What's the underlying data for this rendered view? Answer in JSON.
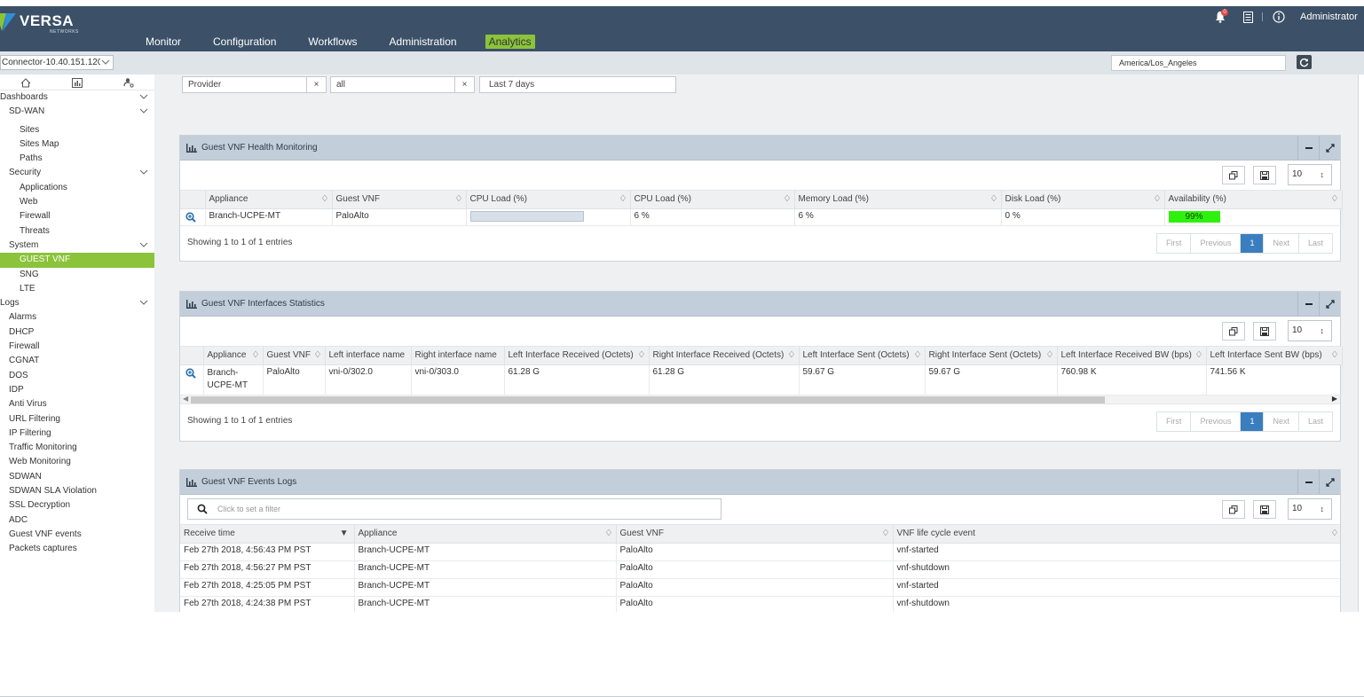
{
  "brand": {
    "name": "VERSA",
    "sub": "NETWORKS"
  },
  "nav": {
    "items": [
      "Monitor",
      "Configuration",
      "Workflows",
      "Administration",
      "Analytics"
    ],
    "active": "Analytics"
  },
  "topbar": {
    "notification_count": "0",
    "user": "Administrator"
  },
  "org_select": "Connector-10.40.151.120",
  "timezone": "America/Los_Angeles",
  "sidebar": {
    "dashboards": "Dashboards",
    "sdwan": "SD-WAN",
    "sdwan_items": [
      "Sites",
      "Sites Map",
      "Paths"
    ],
    "security": "Security",
    "security_items": [
      "Applications",
      "Web",
      "Firewall",
      "Threats"
    ],
    "system": "System",
    "system_items": [
      "GUEST VNF",
      "SNG",
      "LTE"
    ],
    "logs": "Logs",
    "log_items": [
      "Alarms",
      "DHCP",
      "Firewall",
      "CGNAT",
      "DOS",
      "IDP",
      "Anti Virus",
      "URL Filtering",
      "IP Filtering",
      "Traffic Monitoring",
      "Web Monitoring",
      "SDWAN",
      "SDWAN SLA Violation",
      "SSL Decryption",
      "ADC",
      "Guest VNF events",
      "Packets captures"
    ]
  },
  "filters": {
    "provider": "Provider",
    "tenant": "all",
    "range": "Last 7 days",
    "clear": "×"
  },
  "health": {
    "title": "Guest VNF Health Monitoring",
    "page_size": "10",
    "columns": [
      "Appliance",
      "Guest VNF",
      "CPU Load (%)",
      "CPU Load (%)",
      "Memory Load (%)",
      "Disk Load (%)",
      "Availability (%)"
    ],
    "row": {
      "appliance": "Branch-UCPE-MT",
      "vnf": "PaloAlto",
      "cpu_pct": "6 %",
      "mem_pct": "6 %",
      "disk_pct": "0 %",
      "availability": "99%"
    },
    "showing": "Showing 1 to 1 of 1 entries"
  },
  "interfaces": {
    "title": "Guest VNF Interfaces Statistics",
    "page_size": "10",
    "columns": [
      "Appliance",
      "Guest VNF",
      "Left interface name",
      "Right interface name",
      "Left Interface Received (Octets)",
      "Right Interface Received (Octets)",
      "Left Interface Sent (Octets)",
      "Right Interface Sent (Octets)",
      "Left Interface Received BW (bps)",
      "Left Interface Sent BW (bps)"
    ],
    "row": [
      "Branch-UCPE-MT",
      "PaloAlto",
      "vni-0/302.0",
      "vni-0/303.0",
      "61.28 G",
      "61.28 G",
      "59.67 G",
      "59.67 G",
      "760.98 K",
      "741.56 K"
    ],
    "showing": "Showing 1 to 1 of 1 entries"
  },
  "pager": {
    "first": "First",
    "previous": "Previous",
    "current": "1",
    "next": "Next",
    "last": "Last"
  },
  "events": {
    "title": "Guest VNF Events Logs",
    "filter_placeholder": "Click to set a filter",
    "page_size": "10",
    "columns": [
      "Receive time",
      "Appliance",
      "Guest VNF",
      "VNF life cycle event"
    ],
    "rows": [
      [
        "Feb 27th 2018, 4:56:43 PM PST",
        "Branch-UCPE-MT",
        "PaloAlto",
        "vnf-started"
      ],
      [
        "Feb 27th 2018, 4:56:27 PM PST",
        "Branch-UCPE-MT",
        "PaloAlto",
        "vnf-shutdown"
      ],
      [
        "Feb 27th 2018, 4:25:05 PM PST",
        "Branch-UCPE-MT",
        "PaloAlto",
        "vnf-started"
      ],
      [
        "Feb 27th 2018, 4:24:38 PM PST",
        "Branch-UCPE-MT",
        "PaloAlto",
        "vnf-shutdown"
      ]
    ]
  },
  "colors": {
    "header": "#3c5068",
    "accent": "#8bc33a",
    "panel_head": "#c3cedb",
    "pager_active": "#3a7ebf",
    "availability": "#2ef20d"
  }
}
